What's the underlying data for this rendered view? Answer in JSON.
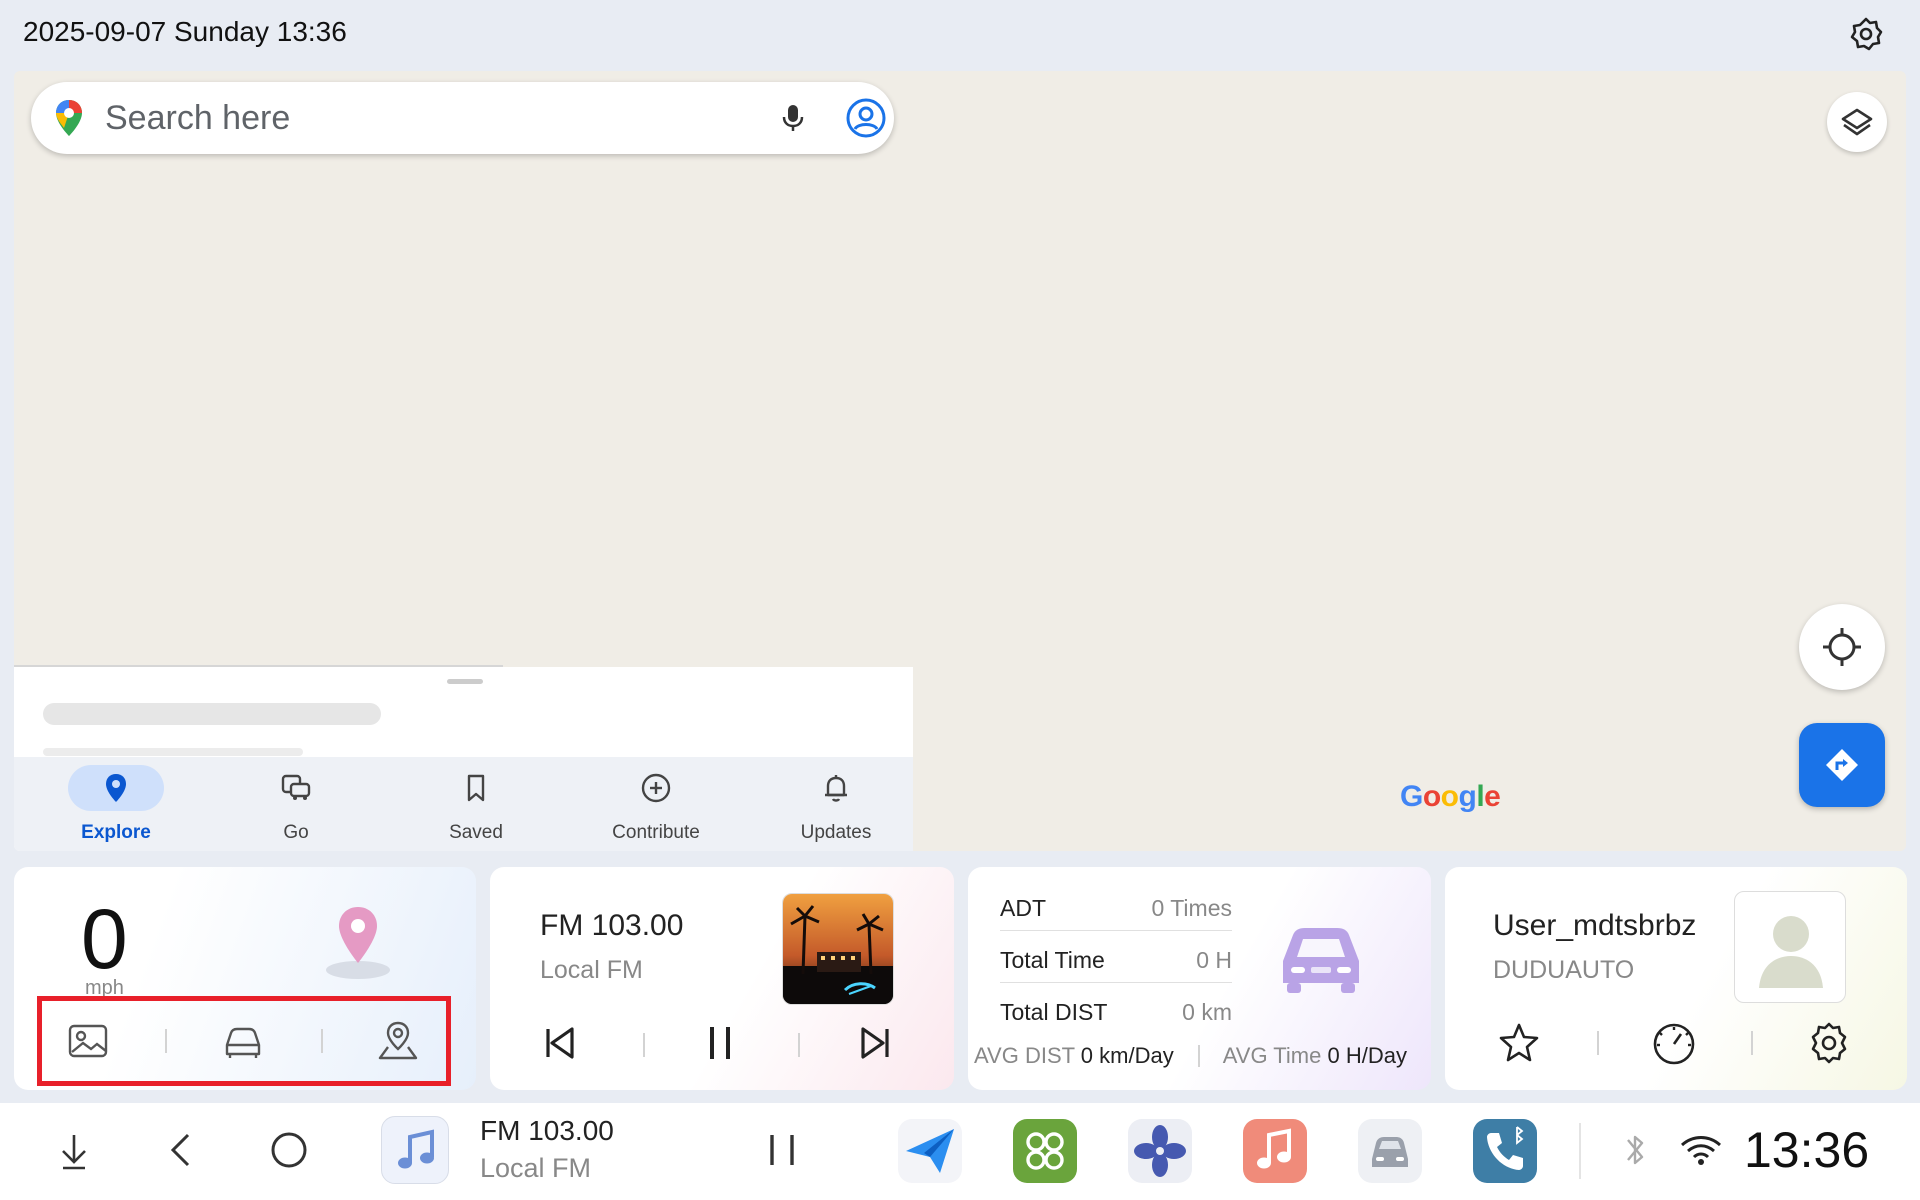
{
  "status_bar": {
    "datetime": "2025-09-07 Sunday 13:36",
    "gear_icon": "gear-icon"
  },
  "map": {
    "search_placeholder": "Search here",
    "attribution": [
      "G",
      "o",
      "o",
      "g",
      "l",
      "e"
    ],
    "attribution_colors": [
      "#4285F4",
      "#EA4335",
      "#FBBC05",
      "#4285F4",
      "#34A853",
      "#EA4335"
    ],
    "accent": "#1a73e8",
    "nav": [
      {
        "label": "Explore",
        "icon": "location-pin-icon",
        "active": true
      },
      {
        "label": "Go",
        "icon": "commute-icon",
        "active": false
      },
      {
        "label": "Saved",
        "icon": "bookmark-icon",
        "active": false
      },
      {
        "label": "Contribute",
        "icon": "add-circle-icon",
        "active": false
      },
      {
        "label": "Updates",
        "icon": "bell-icon",
        "active": false
      }
    ]
  },
  "widgets": {
    "speed": {
      "value": "0",
      "unit": "mph",
      "buttons": [
        "gallery-icon",
        "car-icon",
        "map-pin-icon"
      ]
    },
    "radio": {
      "title": "FM 103.00",
      "subtitle": "Local FM",
      "controls": [
        "previous-icon",
        "pause-icon",
        "next-icon"
      ]
    },
    "stats": {
      "rows": [
        {
          "label": "ADT",
          "value": "0 Times"
        },
        {
          "label": "Total Time",
          "value": "0 H"
        },
        {
          "label": "Total DIST",
          "value": "0 km"
        }
      ],
      "avg_dist_label": "AVG DIST",
      "avg_dist_value": "0 km/Day",
      "avg_time_label": "AVG Time",
      "avg_time_value": "0 H/Day"
    },
    "user": {
      "name": "User_mdtsbrbz",
      "org": "DUDUAUTO",
      "buttons": [
        "star-icon",
        "speedometer-icon",
        "settings-icon"
      ]
    }
  },
  "dock": {
    "radio_title": "FM 103.00",
    "radio_subtitle": "Local FM",
    "clock": "13:36",
    "apps": [
      "navigation-app",
      "apps-grid-app",
      "fan-app",
      "music-app",
      "car-app",
      "phone-app"
    ]
  }
}
